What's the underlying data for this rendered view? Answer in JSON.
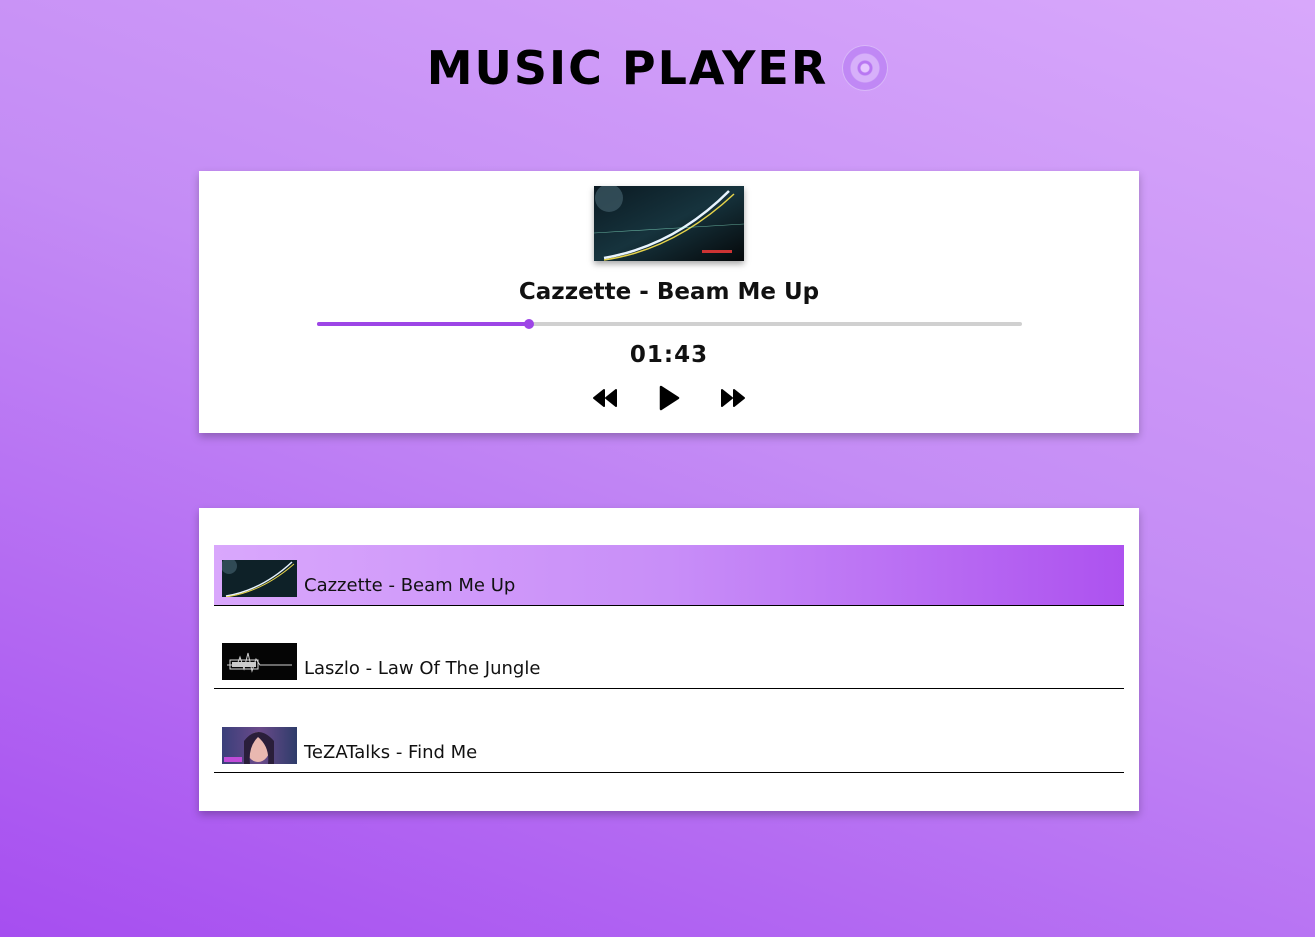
{
  "app": {
    "title": "MUSIC PLAYER"
  },
  "player": {
    "song_title": "Cazzette - Beam Me Up",
    "time": "01:43",
    "progress_fraction": 0.3
  },
  "icons": {
    "title": "disc-icon",
    "prev": "rewind-icon",
    "play": "play-icon",
    "next": "fast-forward-icon"
  },
  "colors": {
    "accent": "#9d45e6",
    "active_row_start": "#d9a7fc",
    "active_row_end": "#ad52ef"
  },
  "playlist": {
    "items": [
      {
        "label": "Cazzette - Beam Me Up",
        "active": true
      },
      {
        "label": "Laszlo - Law Of The Jungle",
        "active": false
      },
      {
        "label": "TeZATalks - Find Me",
        "active": false
      }
    ]
  }
}
